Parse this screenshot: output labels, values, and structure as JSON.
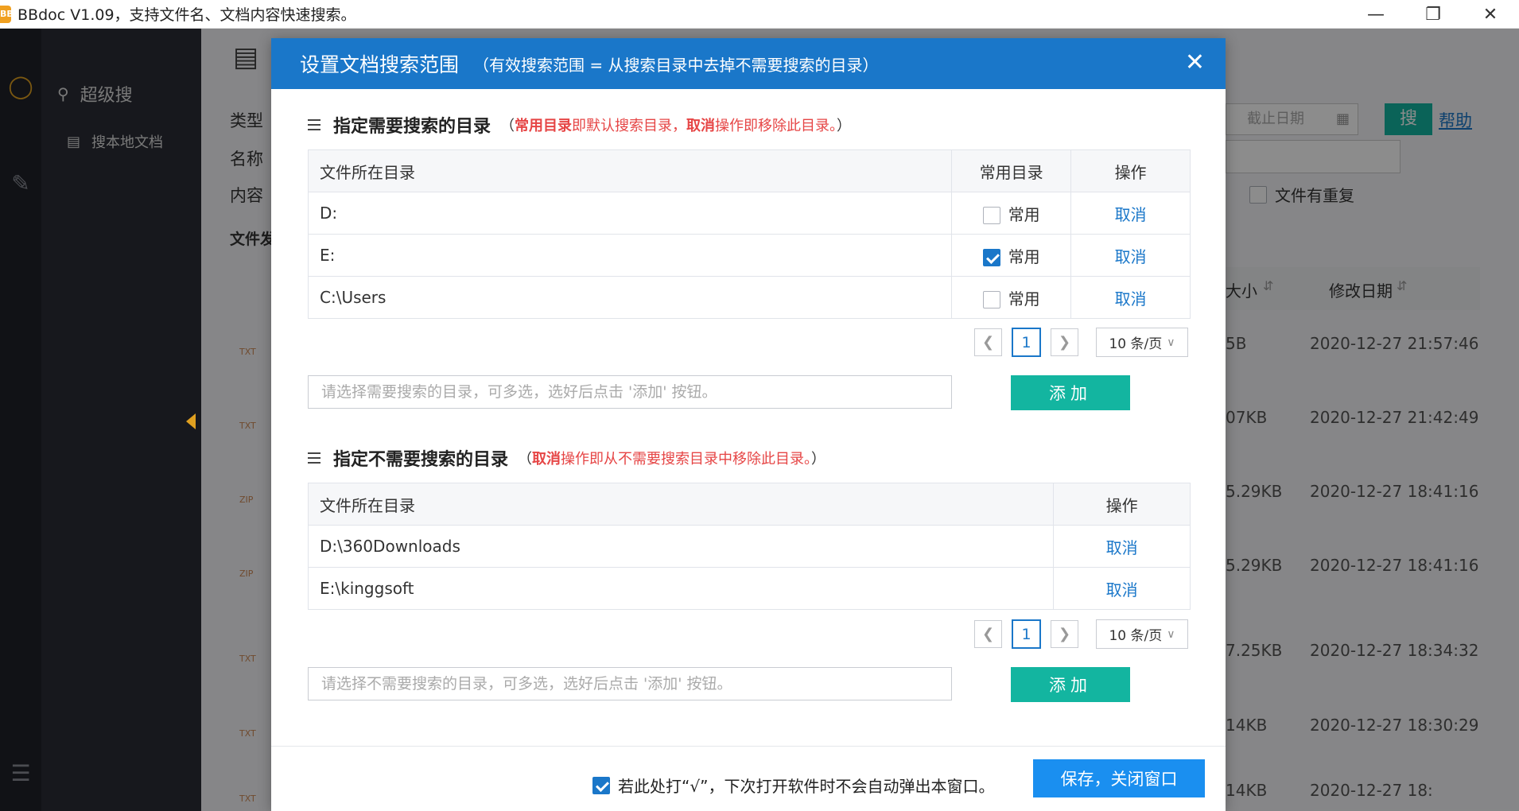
{
  "window": {
    "logo": "BB",
    "title": "BBdoc V1.09，支持文件名、文档内容快速搜索。",
    "minimize": "—",
    "maximize": "❐",
    "close": "✕"
  },
  "sidebar": {
    "menu_title": "超级搜",
    "menu_item": "搜本地文档"
  },
  "background": {
    "filter_labels": [
      "类型",
      "名称",
      "内容"
    ],
    "date_placeholder": "截止日期",
    "search_button": "搜",
    "help_link": "帮助",
    "duplicate_checkbox": "文件有重复",
    "result_label": "文件发",
    "col_size": "大小",
    "col_date": "修改日期",
    "rows": [
      {
        "size": "5B",
        "date": "2020-12-27 21:57:46",
        "type": "TXT"
      },
      {
        "size": "07KB",
        "date": "2020-12-27 21:42:49",
        "type": "TXT"
      },
      {
        "size": "5.29KB",
        "date": "2020-12-27 18:41:16",
        "type": "ZIP"
      },
      {
        "size": "5.29KB",
        "date": "2020-12-27 18:41:16",
        "type": "ZIP"
      },
      {
        "size": "7.25KB",
        "date": "2020-12-27 18:34:32",
        "type": "TXT"
      },
      {
        "size": "14KB",
        "date": "2020-12-27 18:30:29",
        "type": "TXT"
      },
      {
        "size": "14KB",
        "date": "2020-12-27 18:",
        "type": "TXT"
      }
    ]
  },
  "dialog": {
    "title": "设置文档搜索范围",
    "subtitle": "（有效搜索范围 = 从搜索目录中去掉不需要搜索的目录）",
    "close_icon": "✕",
    "include": {
      "title": "指定需要搜索的目录",
      "note_open": "（",
      "note_key1": "常用目录",
      "note_text1": "即默认搜索目录，",
      "note_key2": "取消",
      "note_text2": "操作即移除此目录。",
      "note_close": "）",
      "col_path": "文件所在目录",
      "col_common": "常用目录",
      "col_action": "操作",
      "rows": [
        {
          "path": "D:",
          "common_label": "常用",
          "checked": false,
          "action": "取消"
        },
        {
          "path": "E:",
          "common_label": "常用",
          "checked": true,
          "action": "取消"
        },
        {
          "path": "C:\\Users",
          "common_label": "常用",
          "checked": false,
          "action": "取消"
        }
      ],
      "page": "1",
      "page_size": "10 条/页",
      "input_placeholder": "请选择需要搜索的目录，可多选，选好后点击 '添加' 按钮。",
      "add_button": "添加"
    },
    "exclude": {
      "title": "指定不需要搜索的目录",
      "note_open": "（",
      "note_key": "取消",
      "note_text": "操作即从不需要搜索目录中移除此目录。",
      "note_close": "）",
      "col_path": "文件所在目录",
      "col_action": "操作",
      "rows": [
        {
          "path": "D:\\360Downloads",
          "action": "取消"
        },
        {
          "path": "E:\\kinggsoft",
          "action": "取消"
        }
      ],
      "page": "1",
      "page_size": "10 条/页",
      "input_placeholder": "请选择不需要搜索的目录，可多选，选好后点击 '添加' 按钮。",
      "add_button": "添加"
    },
    "footer": {
      "checkbox_label": "若此处打“√”，下次打开软件时不会自动弹出本窗口。",
      "checkbox_checked": true,
      "save_button": "保存，关闭窗口"
    }
  },
  "colors": {
    "header_blue": "#1a77c9",
    "add_teal": "#13b5a0",
    "save_blue": "#1a8ff0",
    "note_red": "#e64545"
  }
}
